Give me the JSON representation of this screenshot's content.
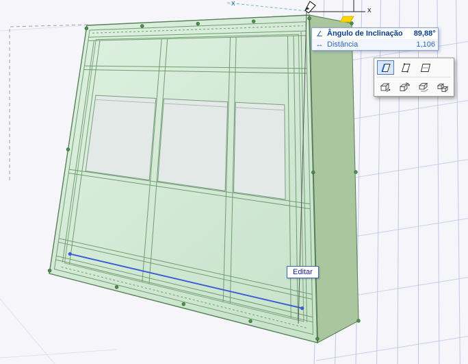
{
  "scene_labels": {
    "x_ghost": "x",
    "x_current": "x"
  },
  "tracker": {
    "rows": [
      {
        "icon": "inclination-angle-icon",
        "glyph": "∠",
        "label": "Ângulo de Inclinação",
        "value": "89,88°"
      },
      {
        "icon": "distance-icon",
        "glyph": "↔",
        "label": "Distância",
        "value": "1,106"
      }
    ]
  },
  "pet_palette": {
    "row1_icons": [
      "tilt-panel-icon",
      "tilt-panel-nodes-icon",
      "tilt-panel-free-icon"
    ],
    "row2_icons": [
      "move-3d-icon",
      "rotate-3d-icon",
      "offset-3d-icon",
      "multiply-3d-icon"
    ]
  },
  "tooltip": {
    "label": "Editar"
  },
  "colors": {
    "wall_face": "#def1e0",
    "wall_face_dark": "#c8e3cb",
    "wall_side": "#a9c69f",
    "wall_top": "#c3dcb8",
    "frame": "#6f9c6f",
    "frame_dark": "#567f57",
    "window": "#e3e9e7",
    "grid": "#b6c1e6",
    "grid_faint": "#dde1f2",
    "ghost": "#99a1ab",
    "snapline": "#6cb8ca",
    "selection_blue": "#3a5fd0",
    "highlight_yellow": "#ffd400",
    "handle_green": "#4d8f4d"
  }
}
